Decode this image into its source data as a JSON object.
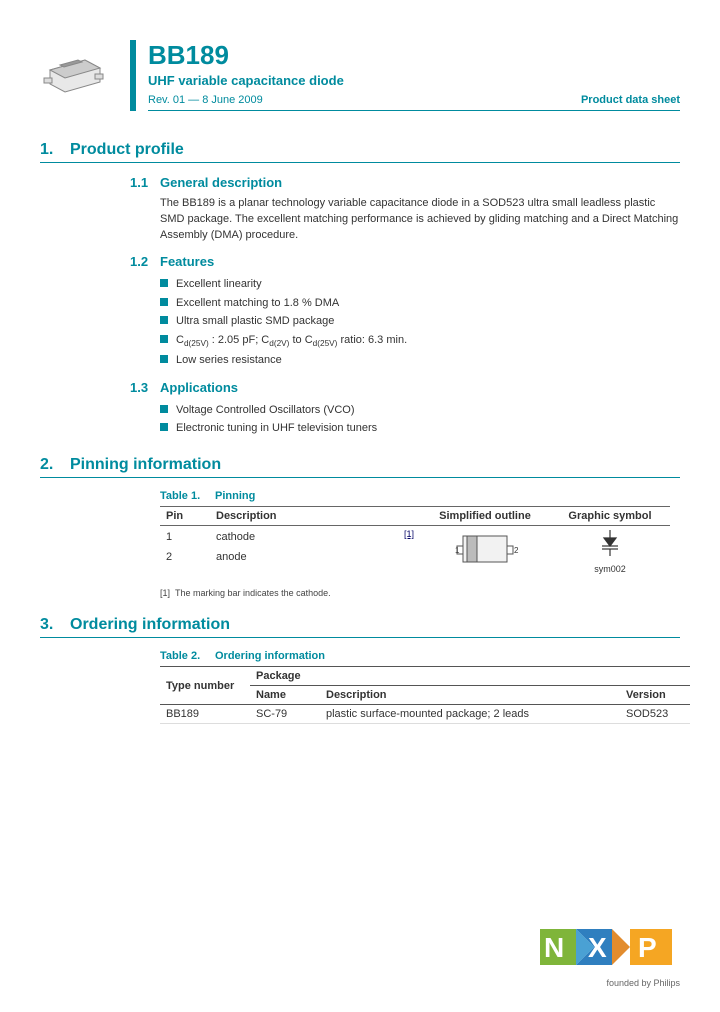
{
  "header": {
    "part_number": "BB189",
    "subtitle": "UHF variable capacitance diode",
    "revision": "Rev. 01 — 8 June 2009",
    "doc_type": "Product data sheet"
  },
  "sections": {
    "s1": {
      "num": "1.",
      "title": "Product profile"
    },
    "s1_1": {
      "num": "1.1",
      "title": "General description"
    },
    "s1_2": {
      "num": "1.2",
      "title": "Features"
    },
    "s1_3": {
      "num": "1.3",
      "title": "Applications"
    },
    "s2": {
      "num": "2.",
      "title": "Pinning information"
    },
    "s3": {
      "num": "3.",
      "title": "Ordering information"
    }
  },
  "general_description": "The BB189 is a planar technology variable capacitance diode in a SOD523 ultra small leadless plastic SMD package. The excellent matching performance is achieved by gliding matching and a Direct Matching Assembly (DMA) procedure.",
  "features": [
    "Excellent linearity",
    "Excellent matching to 1.8 % DMA",
    "Ultra small plastic SMD package",
    "C_d(25V) : 2.05 pF; C_d(2V) to C_d(25V) ratio: 6.3 min.",
    "Low series resistance"
  ],
  "applications": [
    "Voltage Controlled Oscillators (VCO)",
    "Electronic tuning in UHF television tuners"
  ],
  "table1": {
    "caption_label": "Table 1.",
    "caption_title": "Pinning",
    "headers": {
      "pin": "Pin",
      "desc": "Description",
      "outline": "Simplified outline",
      "symbol": "Graphic symbol"
    },
    "rows": [
      {
        "pin": "1",
        "desc": "cathode",
        "ref": "[1]"
      },
      {
        "pin": "2",
        "desc": "anode"
      }
    ],
    "symbol_label": "sym002",
    "footnote_ref": "[1]",
    "footnote_text": "The marking bar indicates the cathode."
  },
  "table2": {
    "caption_label": "Table 2.",
    "caption_title": "Ordering information",
    "headers": {
      "type": "Type number",
      "package": "Package",
      "name": "Name",
      "desc": "Description",
      "version": "Version"
    },
    "row": {
      "type": "BB189",
      "name": "SC-79",
      "desc": "plastic surface-mounted package; 2 leads",
      "version": "SOD523"
    }
  },
  "logo": {
    "tagline": "founded by Philips"
  }
}
